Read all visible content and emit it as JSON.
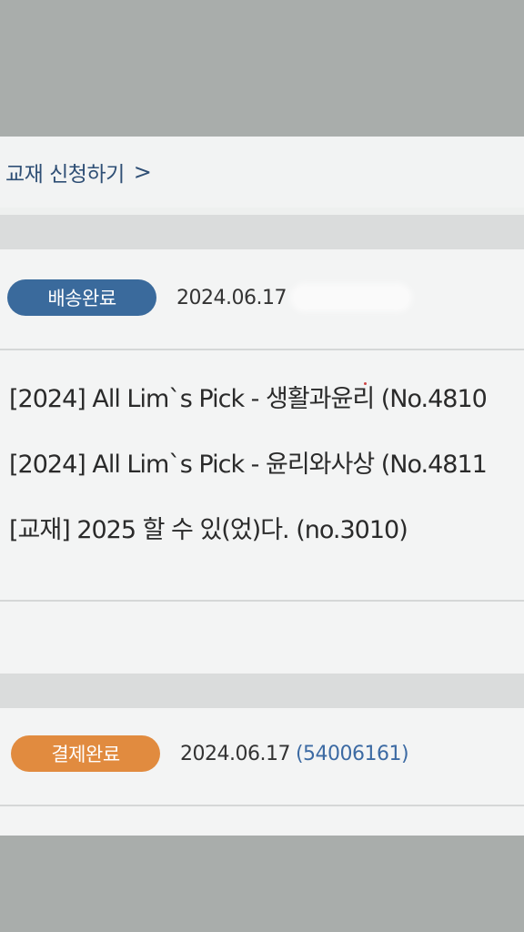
{
  "header": {
    "link_label": "교재 신청하기",
    "chevron": ">"
  },
  "orders": [
    {
      "status": "배송완료",
      "status_color": "#3a6a9c",
      "date": "2024.06.17",
      "items": [
        "[2024] All Lim`s Pick - 생활과윤리 (No.4810",
        "[2024] All Lim`s Pick - 윤리와사상 (No.4811",
        "[교재] 2025 할 수 있(었)다. (no.3010)"
      ]
    },
    {
      "status": "결제완료",
      "status_color": "#e18b3f",
      "date": "2024.06.17",
      "order_no": "(54006161)"
    }
  ]
}
